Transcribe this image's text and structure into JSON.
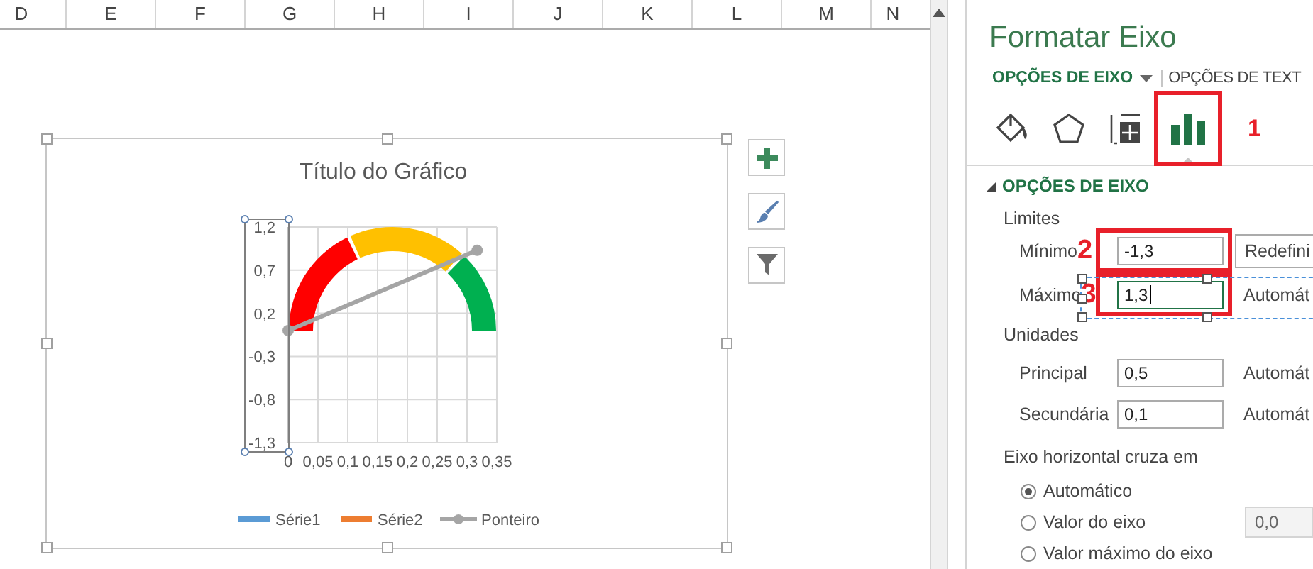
{
  "sheet": {
    "columns": [
      "D",
      "E",
      "F",
      "G",
      "H",
      "I",
      "J",
      "K",
      "L",
      "M",
      "N"
    ]
  },
  "chart": {
    "chart_data": {
      "type": "line",
      "grid": true,
      "title": "Título do Gráfico",
      "x": [
        0,
        0.317
      ],
      "series": [
        {
          "name": "Ponteiro",
          "color": "#a5a5a5",
          "marker": "circle",
          "values": [
            0,
            0.93
          ]
        }
      ],
      "xlim": [
        0,
        0.35
      ],
      "ylim": [
        -1.3,
        1.2
      ],
      "xticks": [
        {
          "value": 0,
          "label": "0"
        },
        {
          "value": 0.05,
          "label": "0,05"
        },
        {
          "value": 0.1,
          "label": "0,1"
        },
        {
          "value": 0.15,
          "label": "0,15"
        },
        {
          "value": 0.2,
          "label": "0,2"
        },
        {
          "value": 0.25,
          "label": "0,25"
        },
        {
          "value": 0.3,
          "label": "0,3"
        },
        {
          "value": 0.35,
          "label": "0,35"
        }
      ],
      "yticks": [
        {
          "value": 1.2,
          "label": "1,2"
        },
        {
          "value": 0.7,
          "label": "0,7"
        },
        {
          "value": 0.2,
          "label": "0,2"
        },
        {
          "value": -0.3,
          "label": "-0,3"
        },
        {
          "value": -0.8,
          "label": "-0,8"
        },
        {
          "value": -1.3,
          "label": "-1,3"
        }
      ]
    },
    "axis_selected": true,
    "legend": [
      {
        "label": "Série1",
        "color": "#5b9bd5",
        "kind": "bar"
      },
      {
        "label": "Série2",
        "color": "#ed7d31",
        "kind": "bar"
      }
    ]
  },
  "panel": {
    "title": "Formatar Eixo",
    "tabs": [
      {
        "label": "OPÇÕES DE EIXO",
        "selected": true,
        "dropdown": true
      },
      {
        "label": "OPÇÕES DE TEXT",
        "selected": false,
        "dropdown": false
      }
    ],
    "icon_tabs": [
      {
        "kind": "fill",
        "selected": false
      },
      {
        "kind": "effects",
        "selected": false
      },
      {
        "kind": "size",
        "selected": false
      },
      {
        "kind": "axis",
        "selected": true,
        "callout": "1"
      }
    ],
    "section": {
      "title": "OPÇÕES DE EIXO",
      "expanded": true
    },
    "groups": [
      {
        "title": "Limites",
        "rows": [
          {
            "label": "Mínimo",
            "value": "-1,3",
            "focused": false,
            "callout": "2",
            "action": {
              "text": "Redefini",
              "kind": "button"
            }
          },
          {
            "label": "Máximo",
            "value": "1,3",
            "focused": true,
            "callout": "3",
            "action": {
              "text": "Automát",
              "kind": "label"
            }
          }
        ]
      },
      {
        "title": "Unidades",
        "rows": [
          {
            "label": "Principal",
            "value": "0,5",
            "focused": false,
            "action": {
              "text": "Automát",
              "kind": "label"
            }
          },
          {
            "label": "Secundária",
            "value": "0,1",
            "focused": false,
            "action": {
              "text": "Automát",
              "kind": "label"
            }
          }
        ]
      }
    ],
    "crosses": {
      "title": "Eixo horizontal cruza em",
      "options": [
        {
          "label": "Automático",
          "selected": true
        },
        {
          "label": "Valor do eixo",
          "selected": false,
          "value": "0,0"
        },
        {
          "label": "Valor máximo do eixo",
          "selected": false
        }
      ]
    }
  }
}
